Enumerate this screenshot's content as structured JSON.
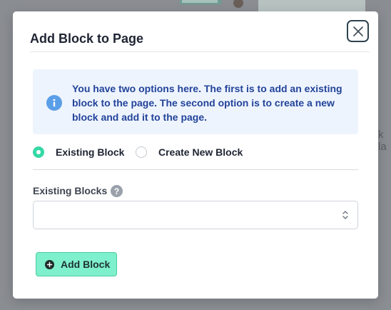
{
  "background": {
    "partial_text": "k la"
  },
  "modal": {
    "title": "Add Block to Page",
    "close_icon": "close-icon",
    "info": {
      "icon": "info-icon",
      "text": "You have two options here. The first is to add an existing block to the page. The second option is to create a new block and add it to the page."
    },
    "options": [
      {
        "label": "Existing Block",
        "checked": true
      },
      {
        "label": "Create New Block",
        "checked": false
      }
    ],
    "existing_blocks": {
      "label": "Existing Blocks",
      "help_icon": "?",
      "selected_value": ""
    },
    "add_button": {
      "label": "Add Block",
      "icon": "plus-circle-icon"
    }
  },
  "colors": {
    "accent": "#35d9a5",
    "button_bg": "#7ef0cb",
    "info_bg": "#eef4fd",
    "info_text": "#22439a",
    "info_icon": "#5b9ee8"
  }
}
